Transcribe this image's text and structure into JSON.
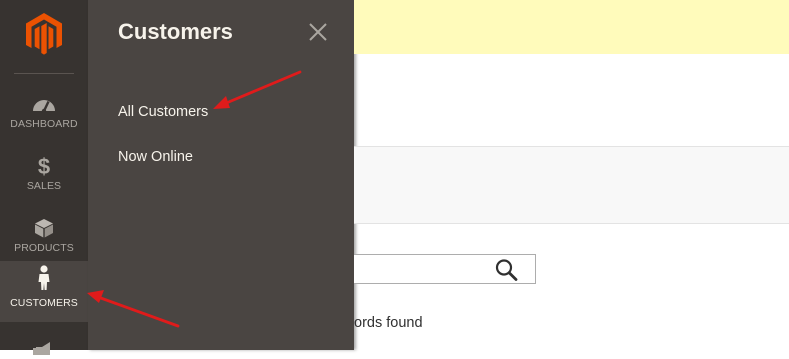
{
  "sidebar": {
    "items": [
      {
        "label": "DASHBOARD",
        "icon": "dashboard-gauge-icon"
      },
      {
        "label": "SALES",
        "icon": "dollar-icon"
      },
      {
        "label": "PRODUCTS",
        "icon": "box-icon"
      },
      {
        "label": "CUSTOMERS",
        "icon": "person-icon",
        "active": true
      },
      {
        "label": "",
        "icon": "megaphone-icon"
      }
    ]
  },
  "flyout": {
    "title": "Customers",
    "close_icon": "close-icon",
    "links": [
      "All Customers",
      "Now Online"
    ]
  },
  "page": {
    "records_text": "ords found",
    "search_icon": "search-icon"
  },
  "colors": {
    "brand": "#eb5202",
    "sidebar_bg": "#373330",
    "flyout_bg": "#4a4542",
    "notice_bg": "#fffbbb",
    "annotation_arrow": "#e01b1b"
  }
}
